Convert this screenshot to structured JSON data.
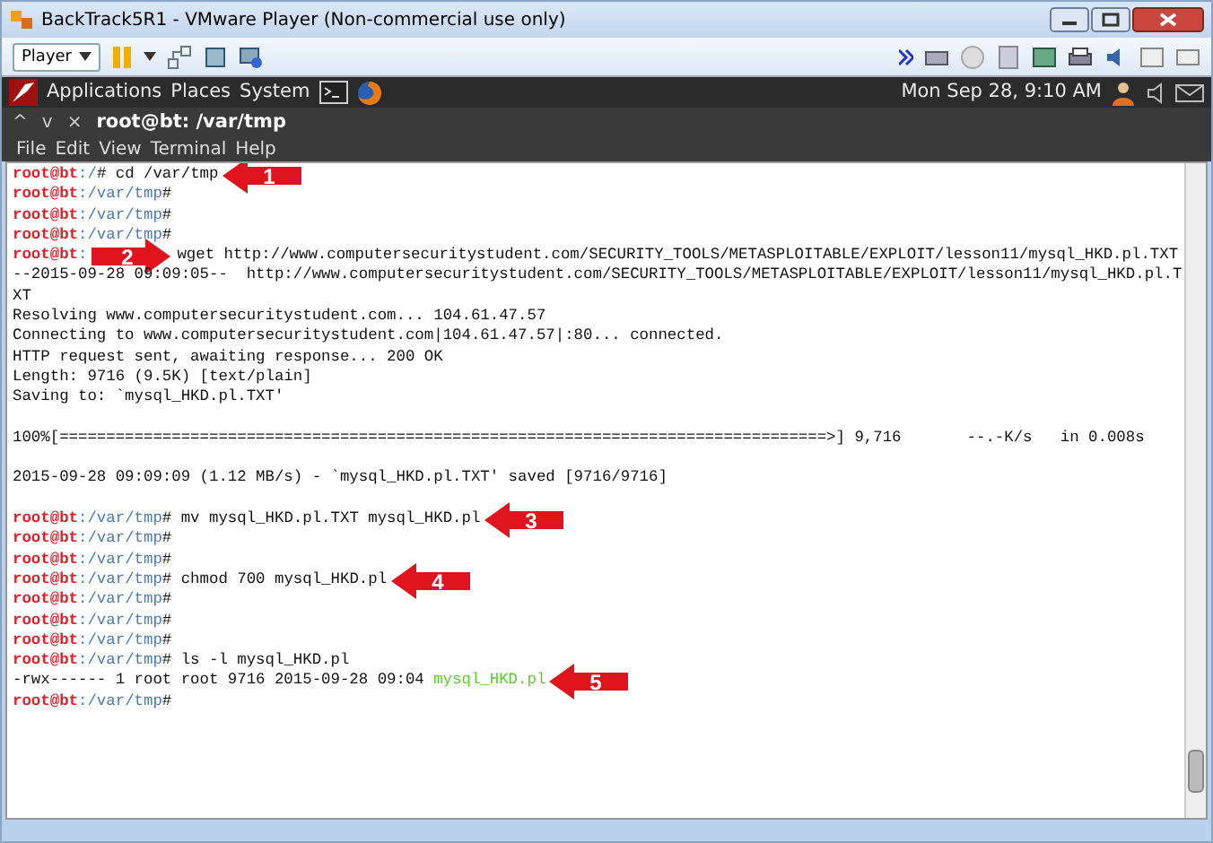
{
  "window": {
    "title": "BackTrack5R1 - VMware Player (Non-commercial use only)"
  },
  "toolbar": {
    "player_menu": "Player"
  },
  "panel": {
    "menus": [
      "Applications",
      "Places",
      "System"
    ],
    "clock": "Mon Sep 28,  9:10 AM"
  },
  "terminal": {
    "controls": [
      "^",
      "v",
      "×"
    ],
    "title": "root@bt: /var/tmp",
    "menu": [
      "File",
      "Edit",
      "View",
      "Terminal",
      "Help"
    ],
    "lines": [
      {
        "kind": "prompt",
        "user": "root@bt",
        "path": ":/",
        "command": "# cd /var/tmp",
        "callout": {
          "label": "1",
          "kind": "left"
        }
      },
      {
        "kind": "prompt",
        "user": "root@bt",
        "path": ":/var/tmp",
        "command": "#"
      },
      {
        "kind": "prompt",
        "user": "root@bt",
        "path": ":/var/tmp",
        "command": "#"
      },
      {
        "kind": "prompt",
        "user": "root@bt",
        "path": ":/var/tmp",
        "command": "#"
      },
      {
        "kind": "prompt",
        "user": "root@bt",
        "path": ":",
        "command": "wget http://www.computersecuritystudent.com/SECURITY_TOOLS/METASPLOITABLE/EXPLOIT/lesson11/mysql_HKD.pl.TXT",
        "callout": {
          "label": "2",
          "kind": "right"
        }
      },
      {
        "kind": "output",
        "text": "--2015-09-28 09:09:05--  http://www.computersecuritystudent.com/SECURITY_TOOLS/METASPLOITABLE/EXPLOIT/lesson11/mysql_HKD.pl.T"
      },
      {
        "kind": "output",
        "text": "XT"
      },
      {
        "kind": "output",
        "text": "Resolving www.computersecuritystudent.com... 104.61.47.57"
      },
      {
        "kind": "output",
        "text": "Connecting to www.computersecuritystudent.com|104.61.47.57|:80... connected."
      },
      {
        "kind": "output",
        "text": "HTTP request sent, awaiting response... 200 OK"
      },
      {
        "kind": "output",
        "text": "Length: 9716 (9.5K) [text/plain]"
      },
      {
        "kind": "output",
        "text": "Saving to: `mysql_HKD.pl.TXT'"
      },
      {
        "kind": "blank"
      },
      {
        "kind": "output",
        "text": "100%[==================================================================================>] 9,716       --.-K/s   in 0.008s"
      },
      {
        "kind": "blank"
      },
      {
        "kind": "output",
        "text": "2015-09-28 09:09:09 (1.12 MB/s) - `mysql_HKD.pl.TXT' saved [9716/9716]"
      },
      {
        "kind": "blank"
      },
      {
        "kind": "prompt",
        "user": "root@bt",
        "path": ":/var/tmp",
        "command": "# mv mysql_HKD.pl.TXT mysql_HKD.pl",
        "callout": {
          "label": "3",
          "kind": "left"
        }
      },
      {
        "kind": "prompt",
        "user": "root@bt",
        "path": ":/var/tmp",
        "command": "#"
      },
      {
        "kind": "prompt",
        "user": "root@bt",
        "path": ":/var/tmp",
        "command": "#"
      },
      {
        "kind": "prompt",
        "user": "root@bt",
        "path": ":/var/tmp",
        "command": "# chmod 700 mysql_HKD.pl",
        "callout": {
          "label": "4",
          "kind": "left"
        }
      },
      {
        "kind": "prompt",
        "user": "root@bt",
        "path": ":/var/tmp",
        "command": "#"
      },
      {
        "kind": "prompt",
        "user": "root@bt",
        "path": ":/var/tmp",
        "command": "#"
      },
      {
        "kind": "prompt",
        "user": "root@bt",
        "path": ":/var/tmp",
        "command": "#"
      },
      {
        "kind": "prompt",
        "user": "root@bt",
        "path": ":/var/tmp",
        "command": "# ls -l mysql_HKD.pl"
      },
      {
        "kind": "listing",
        "text": "-rwx------ 1 root root 9716 2015-09-28 09:04",
        "file": "mysql_HKD.pl",
        "callout": {
          "label": "5",
          "kind": "left"
        }
      },
      {
        "kind": "prompt",
        "user": "root@bt",
        "path": ":/var/tmp",
        "command": "#"
      }
    ]
  }
}
